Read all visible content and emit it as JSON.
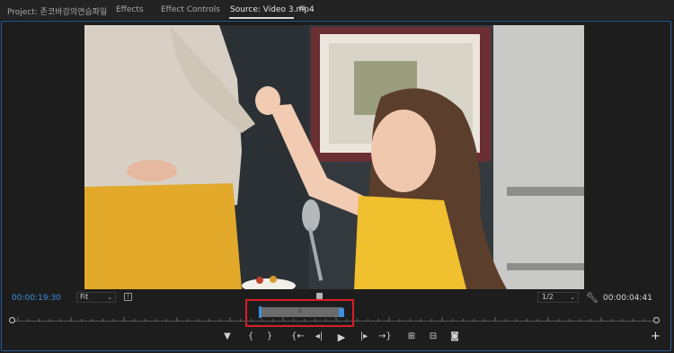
{
  "tabs": [
    {
      "label": "Project: 존코바강의연습파일",
      "active": false
    },
    {
      "label": "Effects",
      "active": false
    },
    {
      "label": "Effect Controls",
      "active": false
    },
    {
      "label": "Source: Video 3.mp4",
      "active": true
    }
  ],
  "tab_menu_icon": "≡",
  "timecode_current": "00:00:19:30",
  "timecode_duration": "00:00:04:41",
  "zoom_select": "Fit",
  "resolution_select": "1/2",
  "colors": {
    "accent_blue": "#3d8fe0",
    "highlight_red": "#d61f26",
    "panel_bg": "#1d1d1d"
  },
  "playhead_fraction": 0.0,
  "in_out_label": "II",
  "transport_controls": [
    {
      "icon": "add-marker-icon",
      "glyph": "▼"
    },
    {
      "icon": "mark-in-icon",
      "glyph": "{"
    },
    {
      "icon": "mark-out-icon",
      "glyph": "}"
    },
    {
      "icon": "go-to-in-icon",
      "glyph": "{←"
    },
    {
      "icon": "step-back-icon",
      "glyph": "◂|"
    },
    {
      "icon": "play-icon",
      "glyph": "▶"
    },
    {
      "icon": "step-forward-icon",
      "glyph": "|▸"
    },
    {
      "icon": "go-to-out-icon",
      "glyph": "→}"
    },
    {
      "icon": "insert-icon",
      "glyph": "⊞"
    },
    {
      "icon": "overwrite-icon",
      "glyph": "⊟"
    },
    {
      "icon": "export-frame-icon",
      "glyph": "◙"
    }
  ],
  "add_button_glyph": "+"
}
